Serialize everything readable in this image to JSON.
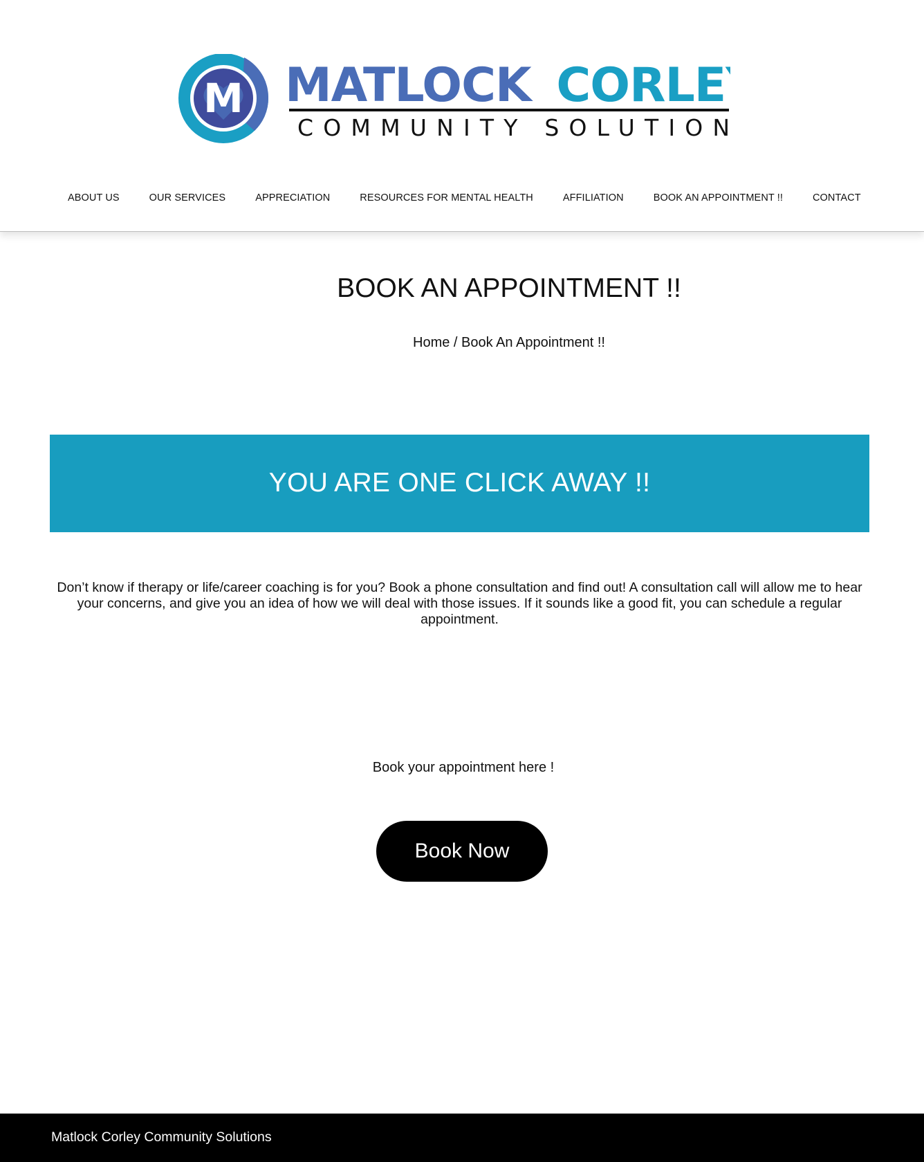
{
  "brand": {
    "name_part1": "MATLOCK",
    "name_part2": "CORLEY",
    "tagline": "COMMUNITY SOLUTIONS",
    "monogram": "M",
    "colors": {
      "blue": "#4a6db7",
      "teal": "#1a9fc4",
      "navy": "#3f4b9c",
      "black": "#000000"
    }
  },
  "nav": {
    "items": [
      {
        "label": "ABOUT US"
      },
      {
        "label": "OUR SERVICES"
      },
      {
        "label": "APPRECIATION"
      },
      {
        "label": "RESOURCES FOR MENTAL HEALTH"
      },
      {
        "label": "AFFILIATION"
      },
      {
        "label": "BOOK AN APPOINTMENT !!"
      },
      {
        "label": "CONTACT"
      }
    ]
  },
  "page": {
    "title": "BOOK AN APPOINTMENT !!",
    "breadcrumb": {
      "home": "Home",
      "separator": " / ",
      "current": "Book An Appointment !!"
    }
  },
  "banner": {
    "text": "YOU ARE ONE CLICK AWAY !!",
    "color": "#189dbf"
  },
  "content": {
    "intro": "Don’t know if therapy or life/career coaching is for you? Book a phone consultation and find out! A consultation call will allow me to hear your concerns, and give you an idea of how we will deal with those issues. If it sounds like a good fit, you can schedule a regular appointment.",
    "book_prompt": "Book your appointment here !",
    "book_button": "Book Now"
  },
  "footer": {
    "text": "Matlock Corley Community Solutions"
  }
}
